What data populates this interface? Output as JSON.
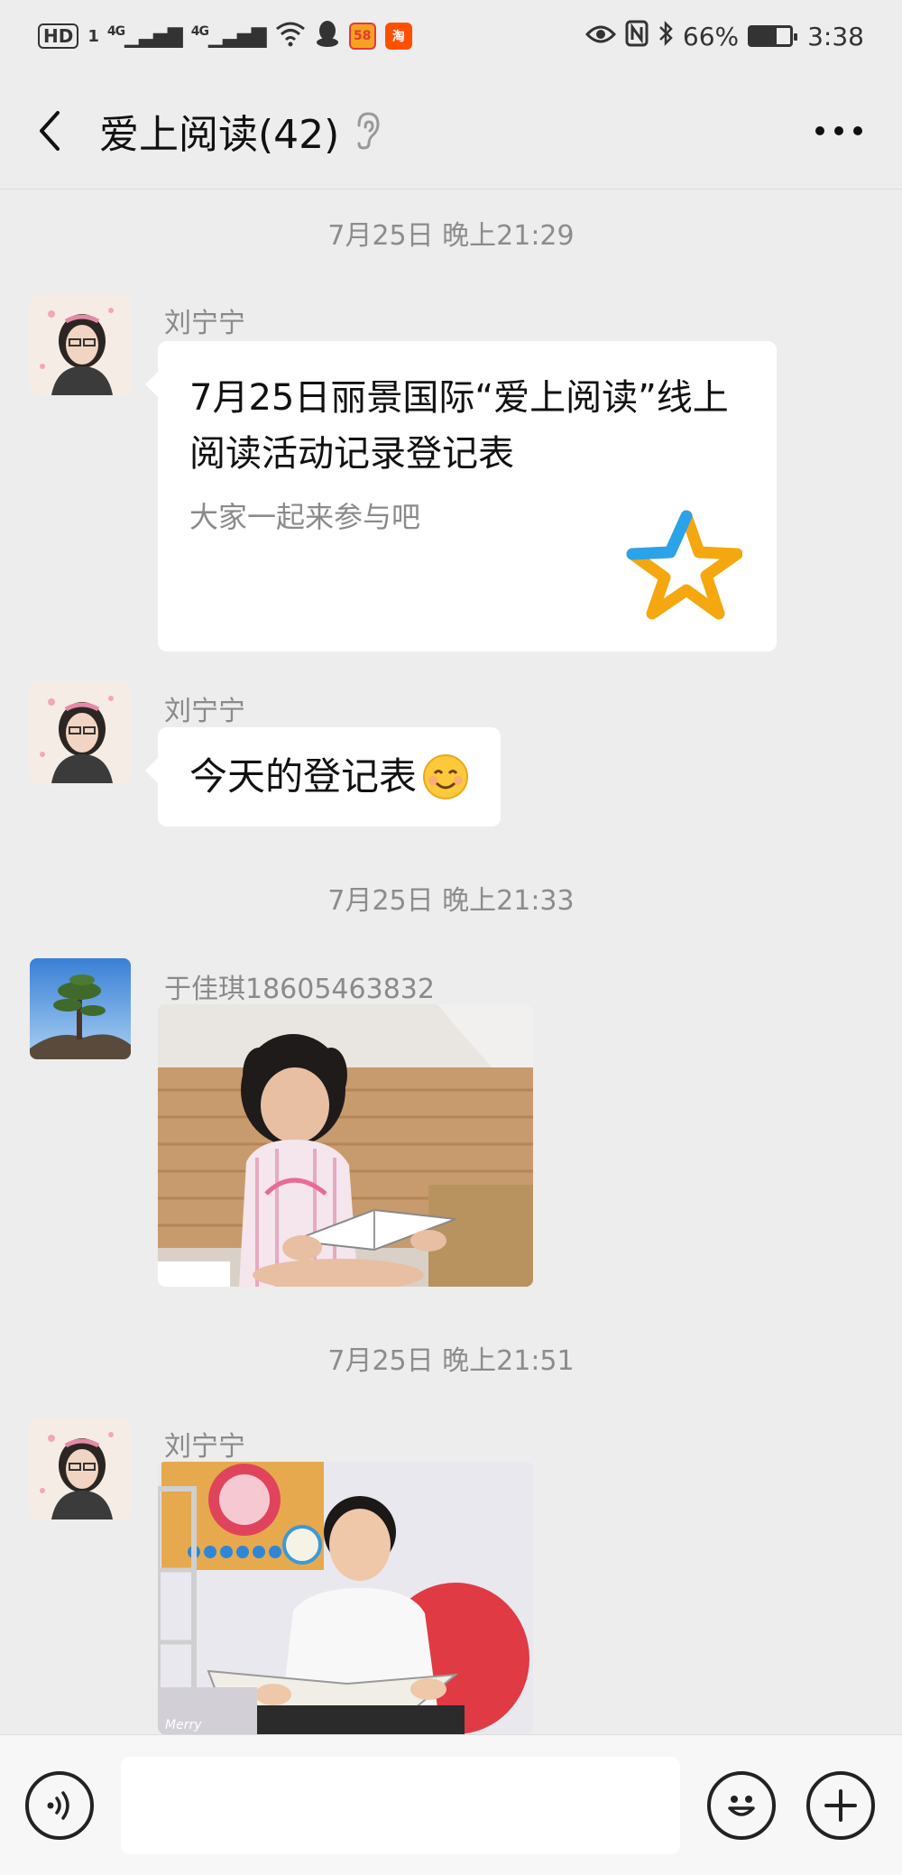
{
  "status_bar": {
    "hd": "HD",
    "sim": "1",
    "net1": "4G",
    "net2": "4G",
    "app_58": "58",
    "app_taobao": "淘",
    "battery_text": "66%",
    "battery_level": 0.66,
    "time": "3:38"
  },
  "header": {
    "title": "爱上阅读(42)",
    "back_icon": "chevron-left-icon",
    "ear_icon": "ear-icon",
    "more_icon": "more-dots-icon"
  },
  "messages": [
    {
      "timestamp": "7月25日 晚上21:29",
      "sender": "刘宁宁",
      "link_title": "7月25日丽景国际“爱上阅读”线上阅读活动记录登记表",
      "link_desc": "大家一起来参与吧",
      "icon": "star-icon"
    },
    {
      "sender": "刘宁宁",
      "text": "今天的登记表",
      "emoji": "smile-emoji"
    },
    {
      "timestamp": "7月25日 晚上21:33",
      "sender": "于佳琪18605463832",
      "image": "girl-reading-photo"
    },
    {
      "timestamp": "7月25日 晚上21:51",
      "sender": "刘宁宁",
      "image": "boy-reading-photo",
      "image_caption": "Merry"
    }
  ],
  "input_bar": {
    "voice_icon": "voice-icon",
    "emoji_icon": "emoji-icon",
    "plus_icon": "plus-icon",
    "input_value": ""
  },
  "colors": {
    "background": "#ededed",
    "bubble": "#ffffff",
    "timestamp_text": "#8c8c8c"
  }
}
